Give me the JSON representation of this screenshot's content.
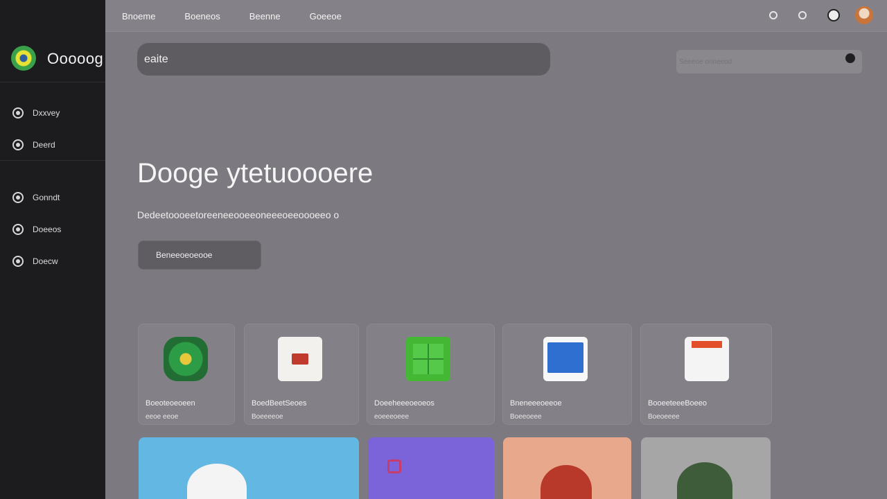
{
  "brand": {
    "name": "Ooooog"
  },
  "sidebar": {
    "items": [
      {
        "label": "Dxxvey"
      },
      {
        "label": "Deerd"
      },
      {
        "label": "Gonndt"
      },
      {
        "label": "Doeeos"
      },
      {
        "label": "Doecw"
      }
    ]
  },
  "topnav": {
    "items": [
      {
        "label": "Bnoeme"
      },
      {
        "label": "Boeneos"
      },
      {
        "label": "Beenne"
      },
      {
        "label": "Goeeoe"
      }
    ]
  },
  "search": {
    "value": "eaite",
    "filter_placeholder": "Seeeoe onneeod"
  },
  "hero": {
    "title": "Dooge ytetuoooere",
    "subtitle": "Dedeetoooeetoreeneeooeeoneeeoeeoooeeo o",
    "button_label": "Beneeoeoeooe"
  },
  "apps": [
    {
      "name": "Boeoteoeoeen",
      "sub": "eeoe eeoe"
    },
    {
      "name": "BoedBeetSeoes",
      "sub": "Boeeeeoe"
    },
    {
      "name": "Doeeheeeoeoeos",
      "sub": "eoeeeoeee"
    },
    {
      "name": "Bneneeeoeeoe",
      "sub": "Boeeoeee"
    },
    {
      "name": "BooeeteeeBoeeo",
      "sub": "Boeoeeee"
    }
  ],
  "icons": {
    "brand_logo": "app-logo-icon",
    "sidebar": [
      "circle-icon",
      "circle-icon",
      "circle-icon",
      "circle-icon",
      "circle-icon"
    ],
    "top": [
      "settings-icon",
      "notifications-icon",
      "clock-icon"
    ],
    "filter": "search-icon"
  },
  "colors": {
    "sidebar_bg": "#1c1c1f",
    "page_bg": "#7c7a80",
    "search_bg": "#5e5c60",
    "tile_blue": "#63b7e3",
    "tile_purple": "#7b63d9",
    "tile_peach": "#e8a88c",
    "tile_gray": "#a7a6a6"
  }
}
